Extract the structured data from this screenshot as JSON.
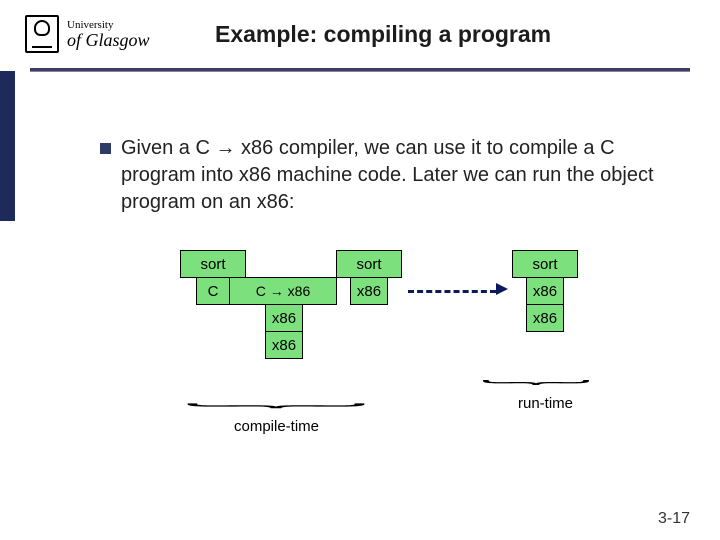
{
  "header": {
    "logo_small": "University",
    "logo_big1": "of",
    "logo_big2": "Glasgow",
    "title": "Example: compiling a program"
  },
  "bullet": {
    "text": "Given a C → x86 compiler, we can use it to compile a C program into x86 machine code. Later we can run the object program on an x86:"
  },
  "diagram": {
    "prog1_top": "sort",
    "prog1_bot": "C",
    "compiler_top": "C  →  x86",
    "compiler_mid": "x86",
    "compiler_bot": "x86",
    "prog2_top": "sort",
    "prog2_bot": "x86",
    "prog3_top": "sort",
    "prog3_bot": "x86",
    "prog3_base": "x86",
    "compile_time": "compile-time",
    "run_time": "run-time"
  },
  "footer": {
    "page": "3-17"
  }
}
